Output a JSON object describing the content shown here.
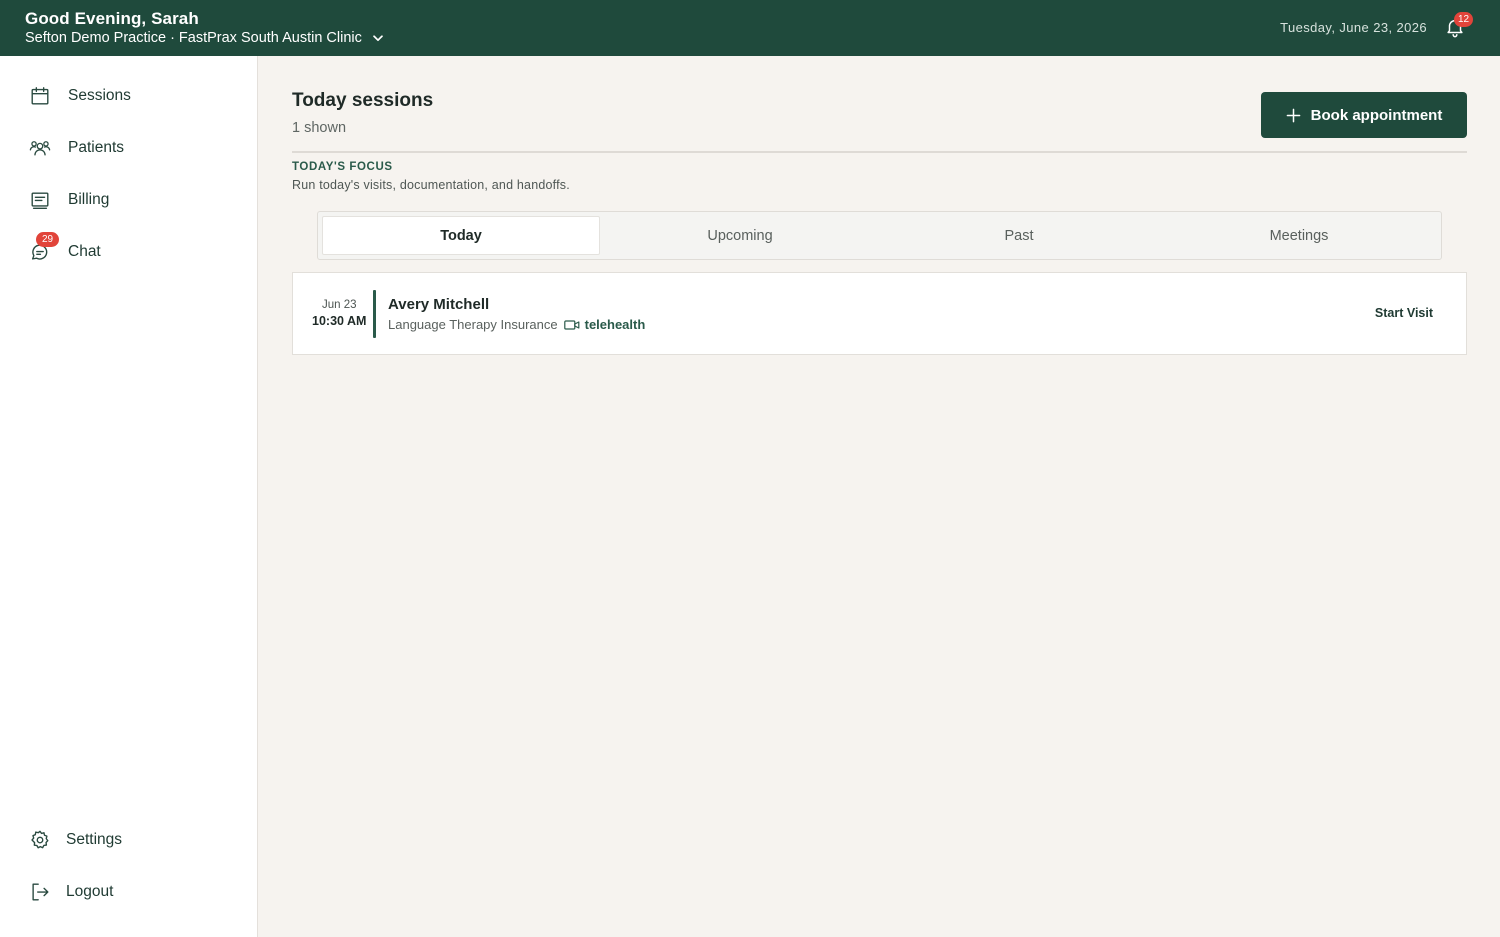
{
  "header": {
    "greeting": "Good Evening, Sarah",
    "practice": "Sefton Demo Practice · FastPrax South Austin Clinic",
    "date": "Tuesday, June 23, 2026",
    "notification_count": "12"
  },
  "sidebar": {
    "items": [
      {
        "label": "Sessions",
        "icon": "calendar-icon"
      },
      {
        "label": "Patients",
        "icon": "users-icon"
      },
      {
        "label": "Billing",
        "icon": "receipt-icon"
      },
      {
        "label": "Chat",
        "icon": "chat-icon",
        "badge": "29"
      }
    ],
    "bottom": [
      {
        "label": "Settings",
        "icon": "gear-icon"
      },
      {
        "label": "Logout",
        "icon": "logout-icon"
      }
    ]
  },
  "main": {
    "title": "Today sessions",
    "shown": "1 shown",
    "book_label": "Book appointment",
    "focus_label": "TODAY'S FOCUS",
    "focus_text": "Run today's visits, documentation, and handoffs.",
    "tabs": [
      {
        "label": "Today",
        "active": true
      },
      {
        "label": "Upcoming",
        "active": false
      },
      {
        "label": "Past",
        "active": false
      },
      {
        "label": "Meetings",
        "active": false
      }
    ],
    "sessions": [
      {
        "date": "Jun 23",
        "time": "10:30 AM",
        "patient": "Avery Mitchell",
        "service": "Language Therapy Insurance",
        "mode": "telehealth",
        "action": "Start Visit"
      }
    ]
  },
  "colors": {
    "brand": "#1f4a3c",
    "badge": "#e1443a",
    "background": "#f6f3ef"
  }
}
